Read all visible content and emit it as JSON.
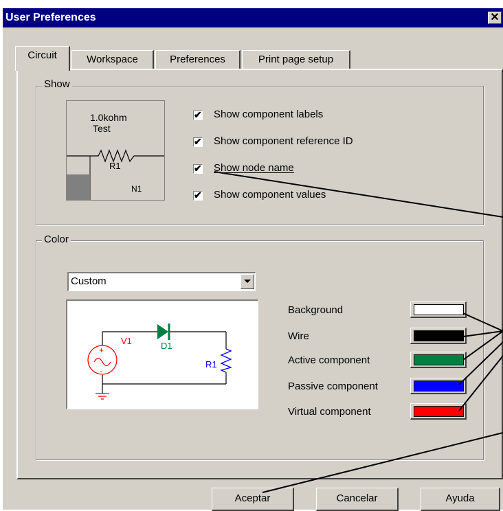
{
  "window": {
    "title": "User Preferences",
    "close_label": "✕"
  },
  "tabs": [
    {
      "label": "Circuit",
      "active": true
    },
    {
      "label": "Workspace",
      "active": false
    },
    {
      "label": "Preferences",
      "active": false
    },
    {
      "label": "Print page setup",
      "active": false
    }
  ],
  "show": {
    "legend": "Show",
    "preview": {
      "value": "1.0kohm",
      "label": "Test",
      "ref": "R1",
      "node": "N1"
    },
    "options": [
      {
        "label": "Show component labels",
        "checked": true
      },
      {
        "label": "Show component reference ID",
        "checked": true
      },
      {
        "label": "Show node name",
        "checked": true
      },
      {
        "label": "Show component values",
        "checked": true
      }
    ],
    "check_glyph": "✔"
  },
  "color": {
    "legend": "Color",
    "scheme_selected": "Custom",
    "preview": {
      "source": "V1",
      "diode": "D1",
      "resistor": "R1"
    },
    "items": [
      {
        "label": "Background",
        "color": "#ffffff"
      },
      {
        "label": "Wire",
        "color": "#000000"
      },
      {
        "label": "Active component",
        "color": "#008040"
      },
      {
        "label": "Passive component",
        "color": "#0000ff"
      },
      {
        "label": "Virtual component",
        "color": "#ff0000"
      }
    ]
  },
  "buttons": {
    "ok": "Aceptar",
    "cancel": "Cancelar",
    "help": "Ayuda"
  }
}
